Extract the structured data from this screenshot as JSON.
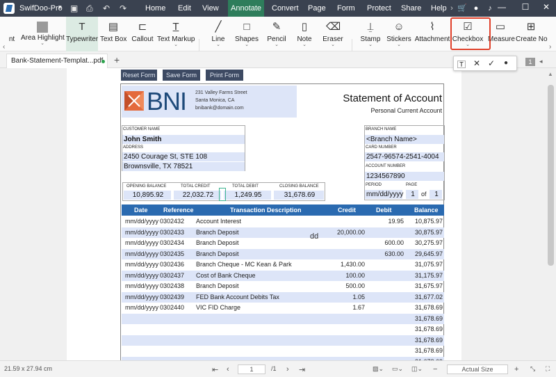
{
  "app": {
    "name": "SwifDoo-Pro"
  },
  "menus": [
    "Home",
    "Edit",
    "View",
    "Annotate",
    "Convert",
    "Page",
    "Form",
    "Protect",
    "Share",
    "Help"
  ],
  "active_menu": "Annotate",
  "ribbon": {
    "tools": [
      "nt",
      "Area Highlight",
      "Typewriter",
      "Text Box",
      "Callout",
      "Text Markup",
      "Line",
      "Shapes",
      "Pencil",
      "Note",
      "Eraser",
      "Stamp",
      "Stickers",
      "Attachment",
      "Checkbox",
      "Measure",
      "Create No"
    ],
    "selected": "Typewriter",
    "highlighted": "Checkbox"
  },
  "tab": {
    "title": "Bank-Statement-Templat...pdf *"
  },
  "page_indicator": "1",
  "form_buttons": {
    "reset": "Reset Form",
    "save": "Save Form",
    "print": "Print Form"
  },
  "statement": {
    "bank_name": "BNI",
    "address_lines": [
      "231 Valley Farms Street",
      "Santa Monica, CA",
      "bnibank@domain.com"
    ],
    "title": "Statement of Account",
    "subtitle": "Personal Current Account",
    "customer_name_label": "CUSTOMER NAME",
    "customer_name": "John Smith",
    "address_label": "ADDRESS",
    "address1": "2450 Courage St, STE 108",
    "address2": "Brownsville, TX 78521",
    "branch_name_label": "BRANCH NAME",
    "branch_name": "<Branch Name>",
    "card_number_label": "CARD NUMBER",
    "card_number": "2547-96574-2541-4004",
    "account_number_label": "ACCOUNT NUMBER",
    "account_number": "1234567890",
    "period_label": "PERIOD",
    "period": "mm/dd/yyyy",
    "page_label": "PAGE",
    "page_current": "1",
    "page_of": "of",
    "page_total": "1",
    "summary_labels": [
      "OPENING BALANCE",
      "TOTAL CREDIT",
      "TOTAL DEBIT",
      "CLOSING BALANCE"
    ],
    "summary_values": [
      "10,895.92",
      "22,032.72",
      "1,249.95",
      "31,678.69"
    ],
    "columns": [
      "Date",
      "Reference",
      "Transaction Description",
      "Credit",
      "Debit",
      "Balance"
    ],
    "rows": [
      [
        "mm/dd/yyyy",
        "0302432",
        "Account Interest",
        "",
        "19.95",
        "10,875.97"
      ],
      [
        "mm/dd/yyyy",
        "0302433",
        "Branch Deposit",
        "20,000.00",
        "",
        "30,875.97"
      ],
      [
        "mm/dd/yyyy",
        "0302434",
        "Branch Deposit",
        "",
        "600.00",
        "30,275.97"
      ],
      [
        "mm/dd/yyyy",
        "0302435",
        "Branch Deposit",
        "",
        "630.00",
        "29,645.97"
      ],
      [
        "mm/dd/yyyy",
        "0302436",
        "Branch Cheque - MC Kean & Park",
        "1,430.00",
        "",
        "31,075.97"
      ],
      [
        "mm/dd/yyyy",
        "0302437",
        "Cost of Bank Cheque",
        "100.00",
        "",
        "31,175.97"
      ],
      [
        "mm/dd/yyyy",
        "0302438",
        "Branch Deposit",
        "500.00",
        "",
        "31,675.97"
      ],
      [
        "mm/dd/yyyy",
        "0302439",
        "FED Bank Account Debits Tax",
        "1.05",
        "",
        "31,677.02"
      ],
      [
        "mm/dd/yyyy",
        "0302440",
        "VIC FID Charge",
        "1.67",
        "",
        "31,678.69"
      ],
      [
        "",
        "",
        "",
        "",
        "",
        "31,678.69"
      ],
      [
        "",
        "",
        "",
        "",
        "",
        "31,678.69"
      ],
      [
        "",
        "",
        "",
        "",
        "",
        "31,678.69"
      ],
      [
        "",
        "",
        "",
        "",
        "",
        "31,678.69"
      ],
      [
        "",
        "",
        "",
        "",
        "",
        "31,678.69"
      ]
    ],
    "typed_text": "dd"
  },
  "status": {
    "page_size": "21.59 x 27.94 cm",
    "page_input": "1",
    "page_total": "/1",
    "zoom": "Actual Size"
  },
  "colors": {
    "titlebar": "#3a4250",
    "active_menu": "#2e7d5b",
    "highlight": "#e0402a",
    "table_header": "#2a6ab0",
    "field_bg": "#dde5f8"
  }
}
